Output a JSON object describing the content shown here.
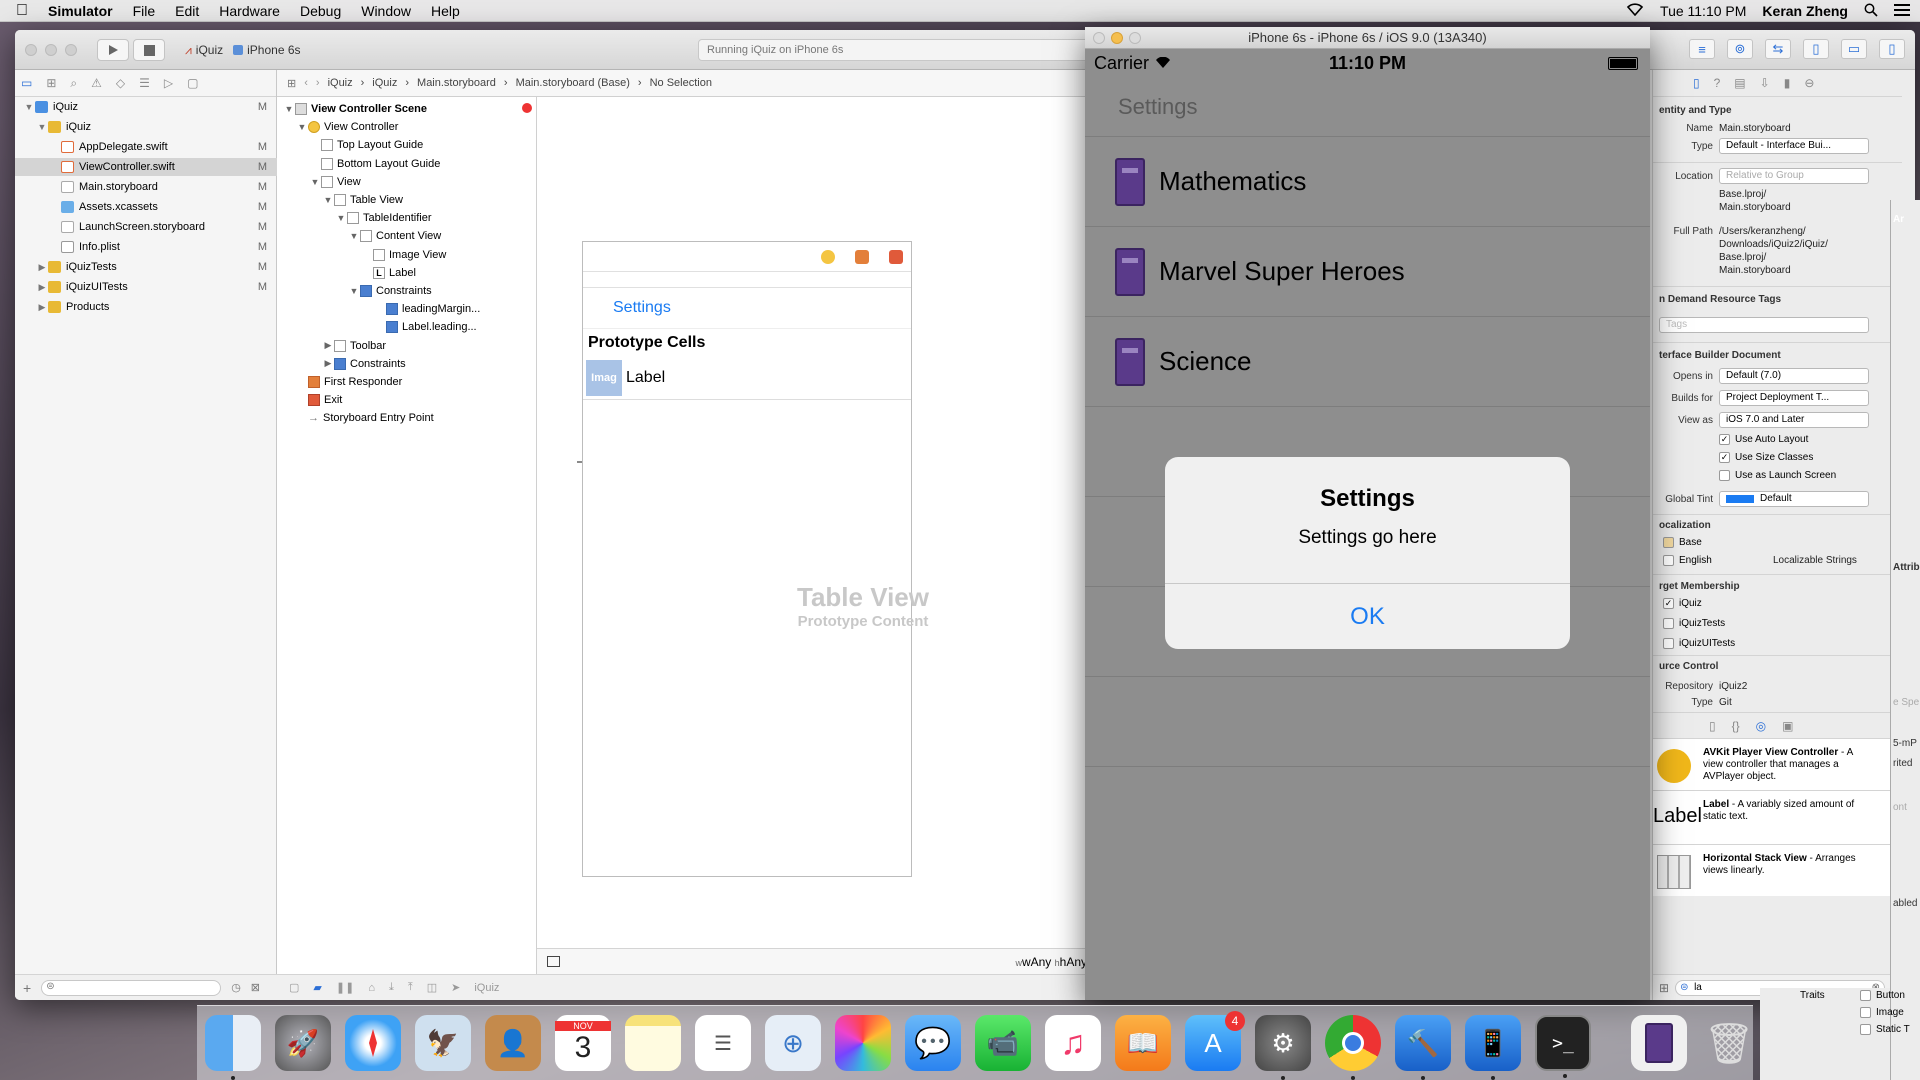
{
  "menubar": {
    "apple": "",
    "items": [
      "Simulator",
      "File",
      "Edit",
      "Hardware",
      "Debug",
      "Window",
      "Help"
    ],
    "clock": "Tue 11:10 PM",
    "user": "Keran Zheng"
  },
  "xcode": {
    "scheme_target": "iQuiz",
    "scheme_device": "iPhone 6s",
    "activity": "Running iQuiz on iPhone 6s",
    "jumpbar": [
      "iQuiz",
      "iQuiz",
      "Main.storyboard",
      "Main.storyboard (Base)",
      "No Selection"
    ],
    "navigator": [
      {
        "label": "iQuiz",
        "badge": "M",
        "indent": 0,
        "icon": "proj",
        "disc": "▼"
      },
      {
        "label": "iQuiz",
        "badge": "",
        "indent": 1,
        "icon": "folder",
        "disc": "▼"
      },
      {
        "label": "AppDelegate.swift",
        "badge": "M",
        "indent": 2,
        "icon": "swift",
        "disc": ""
      },
      {
        "label": "ViewController.swift",
        "badge": "M",
        "indent": 2,
        "icon": "swift",
        "disc": "",
        "sel": true
      },
      {
        "label": "Main.storyboard",
        "badge": "M",
        "indent": 2,
        "icon": "sb",
        "disc": ""
      },
      {
        "label": "Assets.xcassets",
        "badge": "M",
        "indent": 2,
        "icon": "assets",
        "disc": ""
      },
      {
        "label": "LaunchScreen.storyboard",
        "badge": "M",
        "indent": 2,
        "icon": "sb",
        "disc": ""
      },
      {
        "label": "Info.plist",
        "badge": "M",
        "indent": 2,
        "icon": "plist",
        "disc": ""
      },
      {
        "label": "iQuizTests",
        "badge": "M",
        "indent": 1,
        "icon": "folder",
        "disc": "▶"
      },
      {
        "label": "iQuizUITests",
        "badge": "M",
        "indent": 1,
        "icon": "folder",
        "disc": "▶"
      },
      {
        "label": "Products",
        "badge": "",
        "indent": 1,
        "icon": "folder",
        "disc": "▶"
      }
    ],
    "outline": [
      {
        "label": "View Controller Scene",
        "indent": 0,
        "disc": "▼",
        "icon": "",
        "bold": true
      },
      {
        "label": "View Controller",
        "indent": 1,
        "disc": "▼",
        "icon": "vc"
      },
      {
        "label": "Top Layout Guide",
        "indent": 2,
        "disc": "",
        "icon": "box"
      },
      {
        "label": "Bottom Layout Guide",
        "indent": 2,
        "disc": "",
        "icon": "box"
      },
      {
        "label": "View",
        "indent": 2,
        "disc": "▼",
        "icon": "box"
      },
      {
        "label": "Table View",
        "indent": 3,
        "disc": "▼",
        "icon": "box"
      },
      {
        "label": "TableIdentifier",
        "indent": 4,
        "disc": "▼",
        "icon": "box"
      },
      {
        "label": "Content View",
        "indent": 5,
        "disc": "▼",
        "icon": "box"
      },
      {
        "label": "Image View",
        "indent": 6,
        "disc": "",
        "icon": "box"
      },
      {
        "label": "Label",
        "indent": 6,
        "disc": "",
        "icon": "L"
      },
      {
        "label": "Constraints",
        "indent": 5,
        "disc": "▼",
        "icon": "con"
      },
      {
        "label": "leadingMargin...",
        "indent": 7,
        "disc": "",
        "icon": "con"
      },
      {
        "label": "Label.leading...",
        "indent": 7,
        "disc": "",
        "icon": "con"
      },
      {
        "label": "Toolbar",
        "indent": 3,
        "disc": "▶",
        "icon": "box"
      },
      {
        "label": "Constraints",
        "indent": 3,
        "disc": "▶",
        "icon": "con"
      },
      {
        "label": "First Responder",
        "indent": 1,
        "disc": "",
        "icon": "fr"
      },
      {
        "label": "Exit",
        "indent": 1,
        "disc": "",
        "icon": "ex"
      },
      {
        "label": "Storyboard Entry Point",
        "indent": 1,
        "disc": "",
        "icon": "arrow"
      }
    ],
    "scene": {
      "nav_title": "Settings",
      "section": "Prototype Cells",
      "img": "Imag",
      "cell_label": "Label",
      "placeholder_title": "Table View",
      "placeholder_sub": "Prototype Content"
    },
    "size_class": {
      "w": "wAny",
      "h": "hAny"
    },
    "editor_footer": "iQuiz",
    "inspector": {
      "identity_header": "entity and Type",
      "name_label": "Name",
      "name": "Main.storyboard",
      "type_label": "Type",
      "type": "Default - Interface Bui...",
      "location_label": "Location",
      "location": "Relative to Group",
      "location_path": [
        "Base.lproj/",
        "Main.storyboard"
      ],
      "fullpath_label": "Full Path",
      "fullpath": [
        "/Users/keranzheng/",
        "Downloads/iQuiz2/iQuiz/",
        "Base.lproj/",
        "Main.storyboard"
      ],
      "odr_header": "n Demand Resource Tags",
      "tags_placeholder": "Tags",
      "ib_header": "terface Builder Document",
      "opens_label": "Opens in",
      "opens": "Default (7.0)",
      "builds_label": "Builds for",
      "builds": "Project Deployment T...",
      "viewas_label": "View as",
      "viewas": "iOS 7.0 and Later",
      "chk_autolayout": "Use Auto Layout",
      "chk_sizeclasses": "Use Size Classes",
      "chk_launch": "Use as Launch Screen",
      "tint_label": "Global Tint",
      "tint": "Default",
      "loc_header": "ocalization",
      "loc_base": "Base",
      "loc_english": "English",
      "loc_strings": "Localizable Strings",
      "target_header": "rget Membership",
      "targets": [
        "iQuiz",
        "iQuizTests",
        "iQuizUITests"
      ],
      "source_header": "urce Control",
      "repo_label": "Repository",
      "repo": "iQuiz2",
      "sctype_label": "Type",
      "sctype": "Git",
      "library": [
        {
          "title": "AVKit Player View Controller",
          "desc": " - A view controller that manages a AVPlayer object."
        },
        {
          "title": "Label",
          "desc": " - A variably sized amount of static text."
        },
        {
          "title": "Horizontal Stack View",
          "desc": " - Arranges views linearly."
        }
      ],
      "lib_label_glyph": "Label",
      "filter_value": "la"
    },
    "far_right": {
      "ar": "Ar",
      "attrib": "Attrib",
      "spe": "e Spe",
      "mp": "5-mP",
      "rited": "rited",
      "ont": "ont",
      "abled": "abled",
      "traits": "Traits",
      "checks": [
        "Button",
        "Image",
        "Static T"
      ]
    }
  },
  "simulator": {
    "title": "iPhone 6s - iPhone 6s / iOS 9.0 (13A340)",
    "carrier": "Carrier",
    "time": "11:10 PM",
    "nav_title": "Settings",
    "rows": [
      "Mathematics",
      "Marvel Super Heroes",
      "Science"
    ],
    "alert": {
      "title": "Settings",
      "message": "Settings go here",
      "button": "OK"
    }
  },
  "dock": {
    "calendar_month": "NOV",
    "calendar_day": "3",
    "appstore_badge": "4",
    "terminal_prompt": ">_"
  },
  "colors": {
    "accent": "#1a7bf2",
    "book": "#5a3a8a"
  }
}
